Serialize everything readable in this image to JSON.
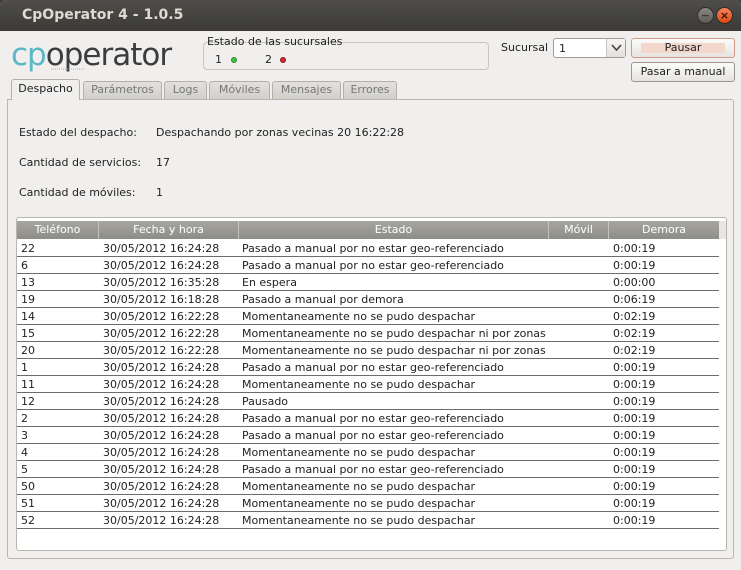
{
  "window": {
    "title": "CpOperator 4 - 1.0.5"
  },
  "logo": {
    "text": "cpoperator",
    "accent_color": "#5cb7c7",
    "main_color": "#3c3c3c"
  },
  "status_group": {
    "title": "Estado de las sucursales",
    "items": [
      {
        "label": "1",
        "status": "green",
        "color": "#3fbf3f"
      },
      {
        "label": "2",
        "status": "red",
        "color": "#d62b2b"
      }
    ]
  },
  "branch": {
    "label": "Sucursal",
    "value": "1"
  },
  "buttons": {
    "pause": "Pausar",
    "manual": "Pasar a manual"
  },
  "tabs": [
    "Despacho",
    "Parámetros",
    "Logs",
    "Móviles",
    "Mensajes",
    "Errores"
  ],
  "info": [
    {
      "label": "Estado del despacho:",
      "value": "Despachando por zonas vecinas 20 16:22:28"
    },
    {
      "label": "Cantidad de servicios:",
      "value": "17"
    },
    {
      "label": "Cantidad de móviles:",
      "value": "1"
    }
  ],
  "table": {
    "columns": [
      "Teléfono",
      "Fecha y hora",
      "Estado",
      "Móvil",
      "Demora"
    ],
    "rows": [
      [
        "22",
        "30/05/2012 16:24:28",
        "Pasado a manual por no estar geo-referenciado",
        "",
        "0:00:19"
      ],
      [
        "6",
        "30/05/2012 16:24:28",
        "Pasado a manual por no estar geo-referenciado",
        "",
        "0:00:19"
      ],
      [
        "13",
        "30/05/2012 16:35:28",
        "En espera",
        "",
        "0:00:00"
      ],
      [
        "19",
        "30/05/2012 16:18:28",
        "Pasado a manual por demora",
        "",
        "0:06:19"
      ],
      [
        "14",
        "30/05/2012 16:22:28",
        "Momentaneamente no se pudo despachar",
        "",
        "0:02:19"
      ],
      [
        "15",
        "30/05/2012 16:22:28",
        "Momentaneamente no se pudo despachar ni por zonas veci…",
        "",
        "0:02:19"
      ],
      [
        "20",
        "30/05/2012 16:22:28",
        "Momentaneamente no se pudo despachar ni por zonas veci…",
        "",
        "0:02:19"
      ],
      [
        "1",
        "30/05/2012 16:24:28",
        "Pasado a manual por no estar geo-referenciado",
        "",
        "0:00:19"
      ],
      [
        "11",
        "30/05/2012 16:24:28",
        "Momentaneamente no se pudo despachar",
        "",
        "0:00:19"
      ],
      [
        "12",
        "30/05/2012 16:24:28",
        "Pausado",
        "",
        "0:00:19"
      ],
      [
        "2",
        "30/05/2012 16:24:28",
        "Pasado a manual por no estar geo-referenciado",
        "",
        "0:00:19"
      ],
      [
        "3",
        "30/05/2012 16:24:28",
        "Pasado a manual por no estar geo-referenciado",
        "",
        "0:00:19"
      ],
      [
        "4",
        "30/05/2012 16:24:28",
        "Momentaneamente no se pudo despachar",
        "",
        "0:00:19"
      ],
      [
        "5",
        "30/05/2012 16:24:28",
        "Pasado a manual por no estar geo-referenciado",
        "",
        "0:00:19"
      ],
      [
        "50",
        "30/05/2012 16:24:28",
        "Momentaneamente no se pudo despachar",
        "",
        "0:00:19"
      ],
      [
        "51",
        "30/05/2012 16:24:28",
        "Momentaneamente no se pudo despachar",
        "",
        "0:00:19"
      ],
      [
        "52",
        "30/05/2012 16:24:28",
        "Momentaneamente no se pudo despachar",
        "",
        "0:00:19"
      ]
    ]
  }
}
